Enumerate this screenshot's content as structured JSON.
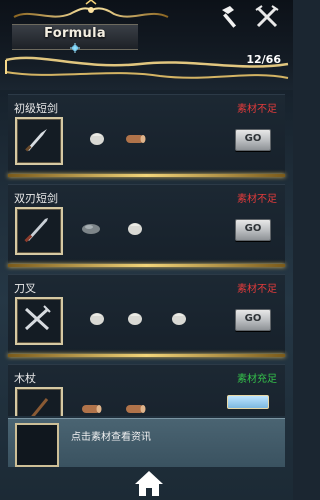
{
  "header": {
    "title": "Formula",
    "count": "12/66",
    "icons": [
      "hammer-icon",
      "crossed-tools-icon"
    ]
  },
  "recipes": [
    {
      "name": "初级短剑",
      "status": "素材不足",
      "status_color": "#e23b3b",
      "item_icon": "short-dagger-icon",
      "materials": [
        "cloth-bundle-icon",
        "wood-log-icon"
      ],
      "button": "GO"
    },
    {
      "name": "双刃短剑",
      "status": "素材不足",
      "status_color": "#e23b3b",
      "item_icon": "double-blade-dagger-icon",
      "materials": [
        "stone-icon",
        "cloth-bundle-icon"
      ],
      "button": "GO"
    },
    {
      "name": "刀叉",
      "status": "素材不足",
      "status_color": "#e23b3b",
      "item_icon": "knife-fork-icon",
      "materials": [
        "cloth-bundle-icon",
        "cloth-bundle-icon",
        "cloth-bundle-icon"
      ],
      "button": "GO"
    },
    {
      "name": "木杖",
      "status": "素材充足",
      "status_color": "#34c04a",
      "item_icon": "wooden-staff-icon",
      "materials": [
        "wood-log-icon",
        "wood-log-icon"
      ],
      "button": ""
    }
  ],
  "info_panel": {
    "hint": "点击素材查看资讯"
  },
  "footer": {
    "icon": "home-icon"
  },
  "colors": {
    "gold": "#f3d57a",
    "insufficient": "#e23b3b",
    "sufficient": "#34c04a"
  }
}
